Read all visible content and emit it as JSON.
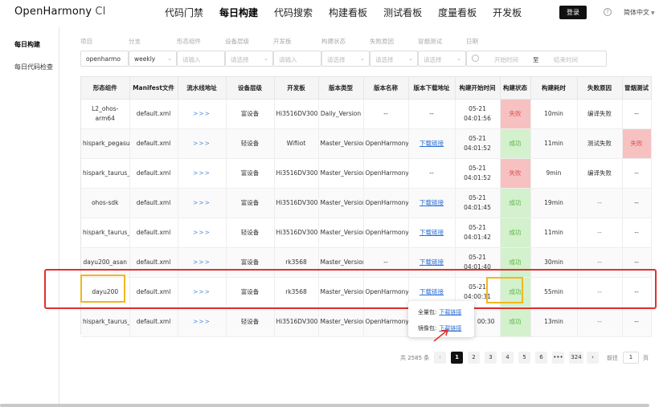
{
  "header": {
    "brand": "OpenHarmony",
    "brand_suffix": "CI",
    "nav": [
      "代码门禁",
      "每日构建",
      "代码搜索",
      "构建看板",
      "测试看板",
      "度量看板",
      "开发板"
    ],
    "login": "登录",
    "help_icon": "?",
    "language": "简体中文"
  },
  "sidebar": {
    "items": [
      "每日构建",
      "每日代码检查"
    ]
  },
  "filters": {
    "labels": [
      "项目",
      "分支",
      "形态组件",
      "设备层级",
      "开发板",
      "构建状态",
      "失败原因",
      "冒烟测试",
      "日期"
    ],
    "project": "openharmo",
    "branch": "weekly",
    "placeholder_input": "请输入",
    "placeholder_select": "请选择",
    "start_time": "开始时间",
    "to": "至",
    "end_time": "结束时间"
  },
  "table": {
    "columns": [
      "形态组件",
      "Manifest文件",
      "流水线地址",
      "设备层级",
      "开发板",
      "版本类型",
      "版本名称",
      "版本下载地址",
      "构建开始时间",
      "构建状态",
      "构建耗时",
      "失败原因",
      "冒烟测试"
    ],
    "rows": [
      {
        "component": "L2_ohos-arm64",
        "manifest": "default.xml",
        "pipeline": ">>>",
        "level": "富设备",
        "board": "Hi3516DV300",
        "vtype": "Daily_Version",
        "vname": "--",
        "download": "--",
        "start": "05-21 04:01:56",
        "status": "失败",
        "duration": "10min",
        "reason": "编译失败",
        "smoke": "--"
      },
      {
        "component": "hispark_pegasus",
        "manifest": "default.xml",
        "pipeline": ">>>",
        "level": "轻设备",
        "board": "Wifiiot",
        "vtype": "Master_Version",
        "vname": "OpenHarmony_3.2.2.3",
        "download": "下载链接",
        "start": "05-21 04:01:52",
        "status": "成功",
        "duration": "11min",
        "reason": "测试失败",
        "smoke": "失败"
      },
      {
        "component": "hispark_taurus_standard",
        "manifest": "default.xml",
        "pipeline": ">>>",
        "level": "富设备",
        "board": "Hi3516DV300",
        "vtype": "Master_Version",
        "vname": "OpenHarmony_3.2.2.3",
        "download": "--",
        "start": "05-21 04:01:52",
        "status": "失败",
        "duration": "9min",
        "reason": "编译失败",
        "smoke": "--"
      },
      {
        "component": "ohos-sdk",
        "manifest": "default.xml",
        "pipeline": ">>>",
        "level": "富设备",
        "board": "Hi3516DV300",
        "vtype": "Master_Version",
        "vname": "OpenHarmony_3.2.2.3",
        "download": "下载链接",
        "start": "05-21 04:01:45",
        "status": "成功",
        "duration": "19min",
        "reason": "--",
        "smoke": "--"
      },
      {
        "component": "hispark_taurus_LiteOS",
        "manifest": "default.xml",
        "pipeline": ">>>",
        "level": "轻设备",
        "board": "Hi3516DV300",
        "vtype": "Master_Version",
        "vname": "OpenHarmony_3.2.2.3",
        "download": "下载链接",
        "start": "05-21 04:01:42",
        "status": "成功",
        "duration": "11min",
        "reason": "--",
        "smoke": "--"
      },
      {
        "component": "dayu200_asan",
        "manifest": "default.xml",
        "pipeline": ">>>",
        "level": "富设备",
        "board": "rk3568",
        "vtype": "Master_Version",
        "vname": "--",
        "download": "下载链接",
        "start": "05-21 04:01:40",
        "status": "成功",
        "duration": "30min",
        "reason": "--",
        "smoke": "--"
      },
      {
        "component": "dayu200",
        "manifest": "default.xml",
        "pipeline": ">>>",
        "level": "富设备",
        "board": "rk3568",
        "vtype": "Master_Version",
        "vname": "OpenHarmony_3.2.2.3",
        "download": "下载链接",
        "start": "05-21 04:00:31",
        "status": "成功",
        "duration": "55min",
        "reason": "--",
        "smoke": "--"
      },
      {
        "component": "hispark_taurus_Linux",
        "manifest": "default.xml",
        "pipeline": ">>>",
        "level": "轻设备",
        "board": "Hi3516DV300",
        "vtype": "Master_Version",
        "vname": "OpenHarmony_3.2.2.3",
        "download": "",
        "start": "00:30",
        "status": "成功",
        "duration": "13min",
        "reason": "--",
        "smoke": "--"
      }
    ]
  },
  "popup": {
    "full_label": "全量包:",
    "image_label": "镜像包:",
    "link": "下载链接"
  },
  "pagination": {
    "total": "共 2585 条",
    "prev": "‹",
    "pages": [
      "1",
      "2",
      "3",
      "4",
      "5",
      "6",
      "•••",
      "324"
    ],
    "next": "›",
    "goto": "前往",
    "page_value": "1",
    "unit": "页"
  },
  "colors": {
    "fail_bg": "#f7c1c1",
    "ok_bg": "#d3f1cc",
    "highlight_red": "#e03030",
    "highlight_yellow": "#f2b71c",
    "link": "#2b6fd6"
  }
}
